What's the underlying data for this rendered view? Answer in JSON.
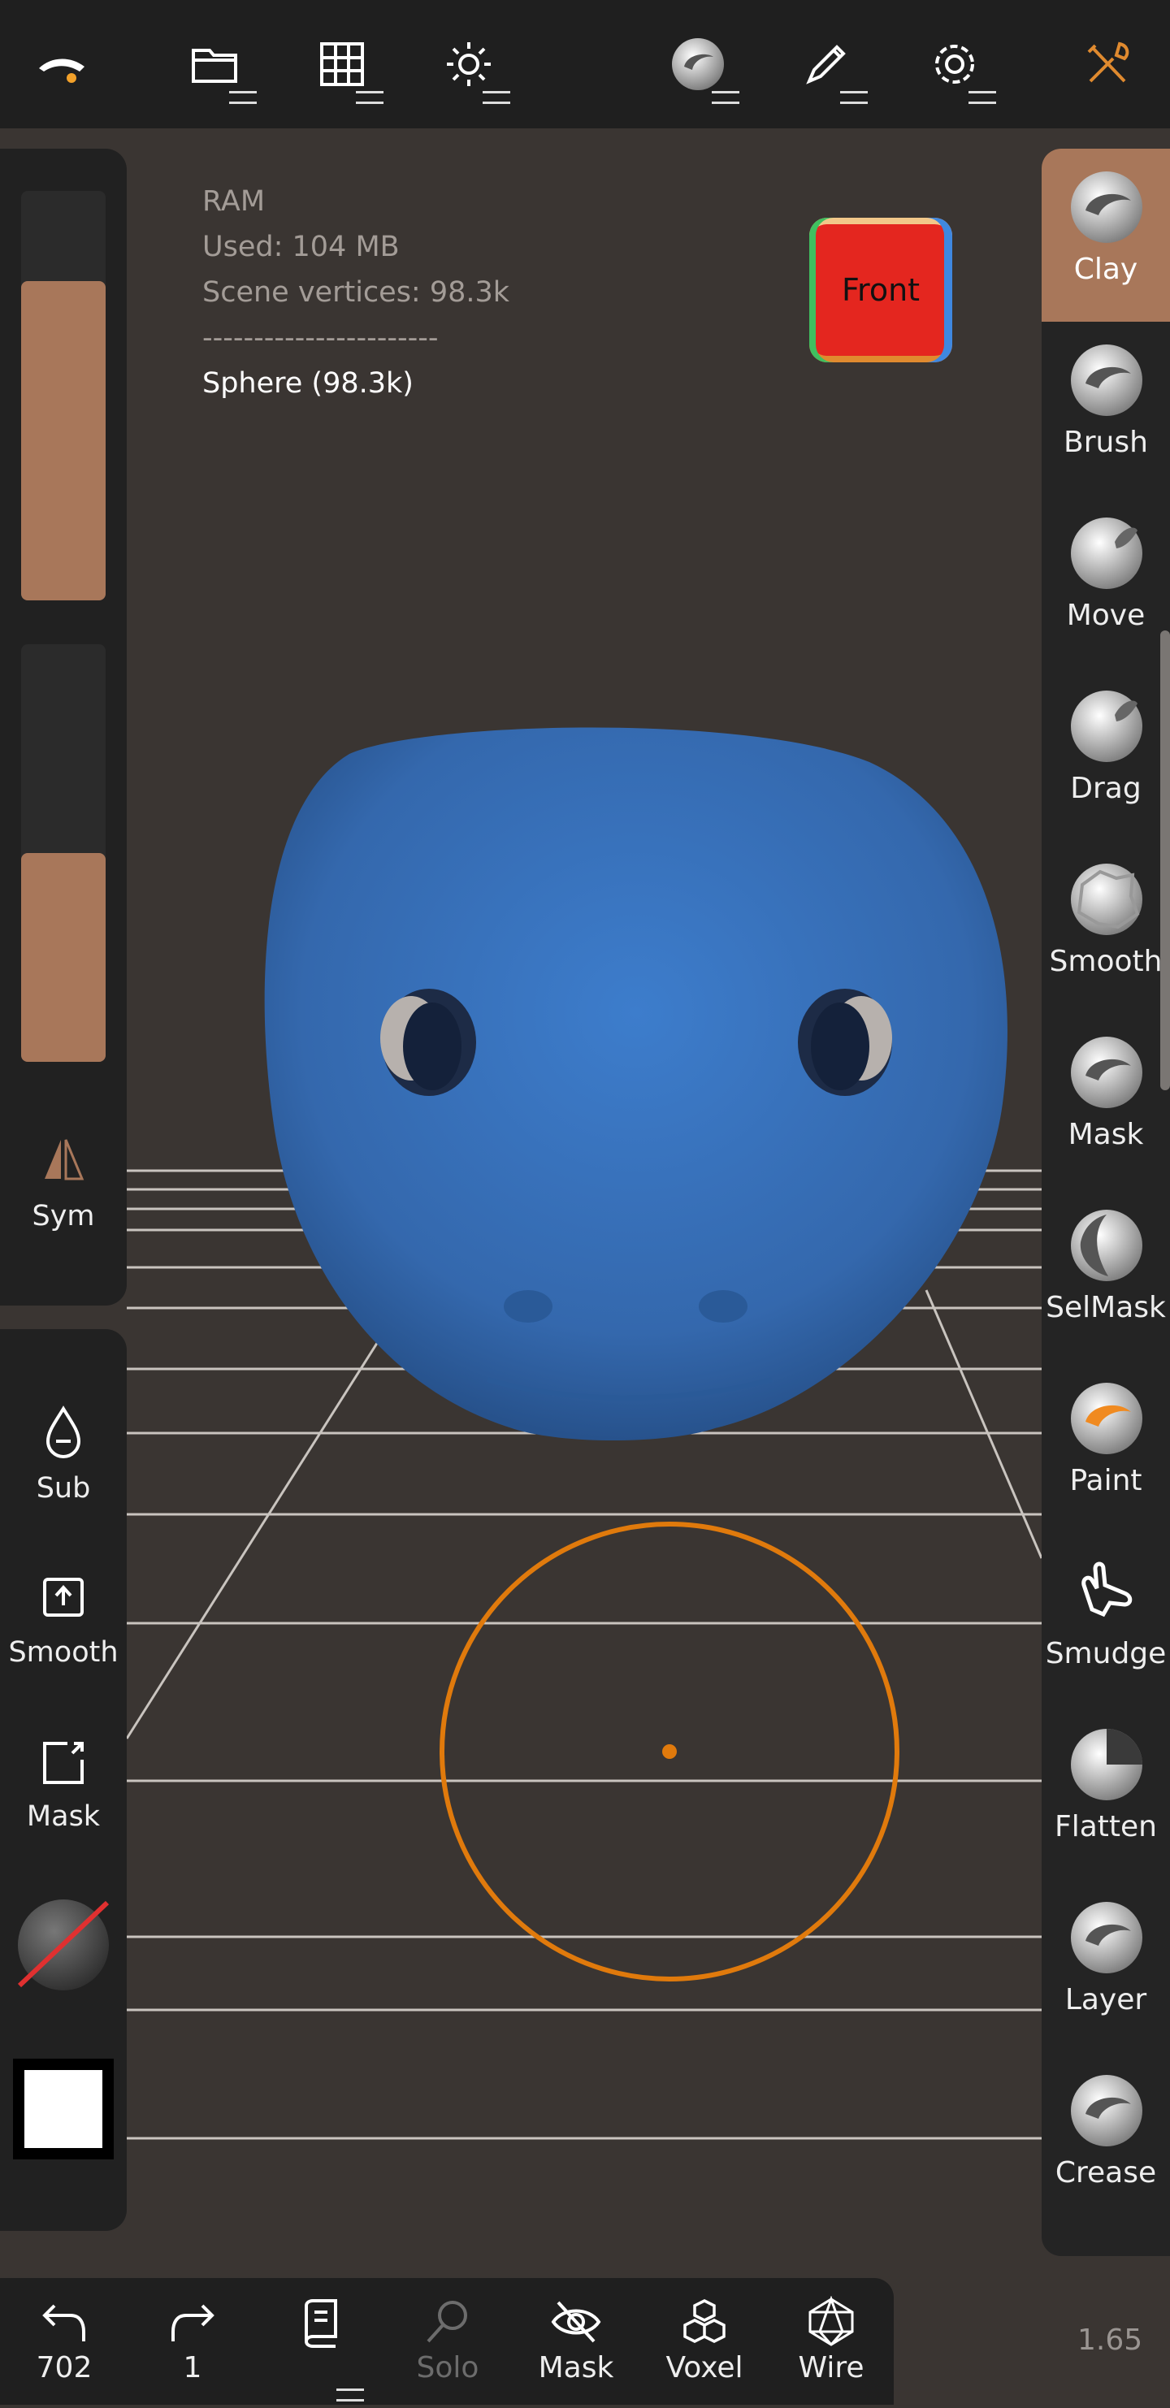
{
  "top_toolbar": {
    "icons": [
      "app-logo-icon",
      "folder-icon",
      "grid-icon",
      "sun-icon",
      "material-sphere-icon",
      "brush-pen-icon",
      "gear-icon",
      "tools-icon"
    ]
  },
  "info": {
    "ram": "RAM",
    "used": "Used: 104 MB",
    "vertices": "Scene vertices: 98.3k",
    "separator": "-----------------------",
    "object": "Sphere (98.3k)"
  },
  "view_cube": {
    "label": "Front"
  },
  "left_panel": {
    "radius_level": 0.78,
    "intensity_level": 0.5,
    "sym_label": "Sym"
  },
  "left_tools": {
    "sub_label": "Sub",
    "smooth_label": "Smooth",
    "mask_label": "Mask"
  },
  "tools": [
    "Clay",
    "Brush",
    "Move",
    "Drag",
    "Smooth",
    "Mask",
    "SelMask",
    "Paint",
    "Smudge",
    "Flatten",
    "Layer",
    "Crease"
  ],
  "bottom_bar": {
    "undo_count": "702",
    "redo_count": "1",
    "solo_label": "Solo",
    "mask_label": "Mask",
    "voxel_label": "Voxel",
    "wire_label": "Wire"
  },
  "version": "1.65",
  "colors": {
    "accent": "#a8775a",
    "brush_ring": "#e07a0c",
    "model": "#3a77c4"
  }
}
